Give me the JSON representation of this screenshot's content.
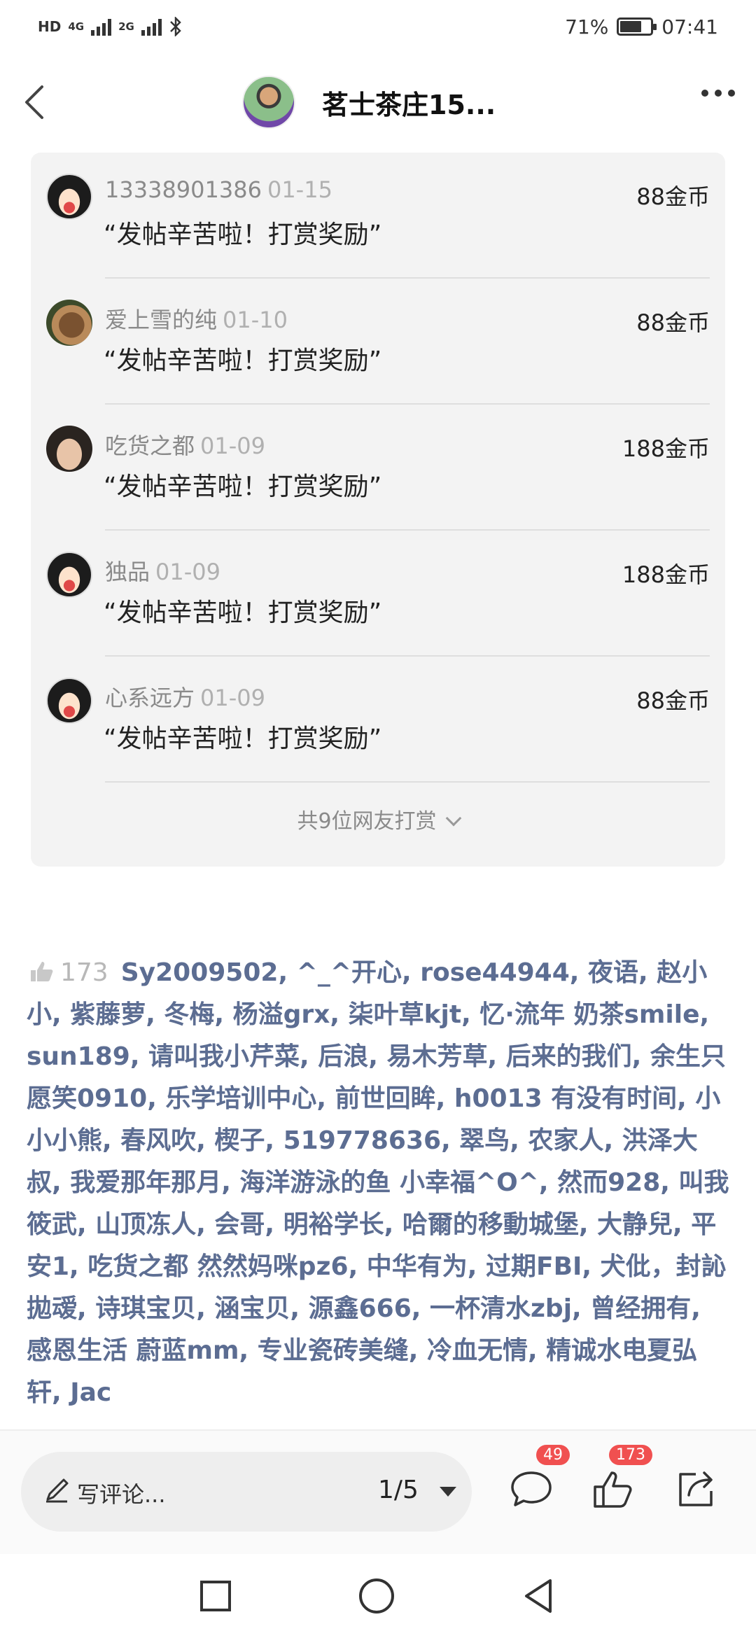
{
  "status_bar": {
    "network_label": "HD",
    "sim1_label": "4G",
    "sim2_label": "2G",
    "battery_percent": 71,
    "battery_text": "71%",
    "time": "07:41"
  },
  "header": {
    "title": "茗士茶庄15..."
  },
  "rewards": {
    "items": [
      {
        "name": "13338901386",
        "date": "01-15",
        "message": "“发帖辛苦啦！打赏奖励”",
        "amount": "88金币",
        "avatar": "cartoon-avatar"
      },
      {
        "name": "爱上雪的纯",
        "date": "01-10",
        "message": "“发帖辛苦啦！打赏奖励”",
        "amount": "88金币",
        "avatar": "dog-photo-avatar"
      },
      {
        "name": "吃货之都",
        "date": "01-09",
        "message": "“发帖辛苦啦！打赏奖励”",
        "amount": "188金币",
        "avatar": "face-photo-avatar"
      },
      {
        "name": "独品",
        "date": "01-09",
        "message": "“发帖辛苦啦！打赏奖励”",
        "amount": "188金币",
        "avatar": "cartoon-avatar"
      },
      {
        "name": "心系远方",
        "date": "01-09",
        "message": "“发帖辛苦啦！打赏奖励”",
        "amount": "88金币",
        "avatar": "cartoon-avatar"
      }
    ],
    "total_label": "共9位网友打赏"
  },
  "likes": {
    "count": "173",
    "names_text": "Sy2009502, ^_^开心, rose44944, 夜语, 赵小小, 紫藤萝, 冬梅, 杨溢grx, 柒叶草kjt, 忆·流年 奶茶smile, sun189, 请叫我小芹菜, 后浪, 易木芳草, 后来的我们, 余生只愿笑0910, 乐学培训中心, 前世回眸, h0013 有没有时间, 小小小熊, 春风吹, 楔子, 519778636, 翠鸟, 农家人, 洪泽大叔, 我爱那年那月, 海洋游泳的鱼 小幸福^O^, 然而928, 叫我筱武, 山顶冻人, 会哥, 明裕学长, 哈爾的移動城堡, 大静兒, 平安1, 吃货之都 然然妈咪pz6, 中华有为, 过期FBI, 犬仳，封訫拋叆, 诗琪宝贝, 涵宝贝, 源鑫666, 一杯清水zbj, 曾经拥有, 感恩生活 蔚蓝mm, 专业瓷砖美缝, 冷血无情, 精诚水电夏弘轩, Jac"
  },
  "bottom_bar": {
    "comment_placeholder": "写评论...",
    "page_indicator": "1/5",
    "comment_badge": "49",
    "like_badge": "173"
  }
}
